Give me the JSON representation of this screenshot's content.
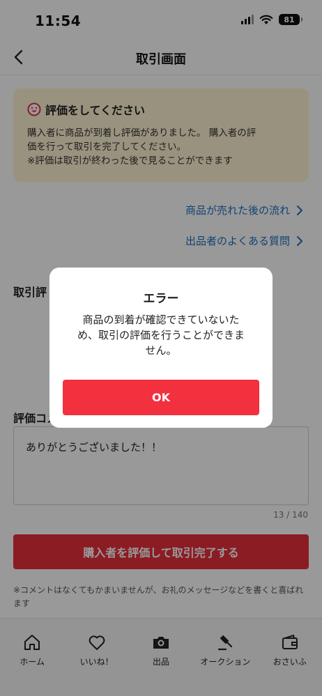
{
  "status_bar": {
    "time": "11:54",
    "battery": "81"
  },
  "nav": {
    "title": "取引画面"
  },
  "notice": {
    "title": "評価をしてください",
    "line1": "購入者に商品が到着し評価がありました。 購入者の評",
    "line2": "価を行って取引を完了してください。",
    "line3": "※評価は取引が終わった後で見ることができます"
  },
  "links": [
    {
      "label": "商品が売れた後の流れ"
    },
    {
      "label": "出品者のよくある質問"
    }
  ],
  "sections": {
    "rating_title": "取引評",
    "comment_title": "評価コメ"
  },
  "comment": {
    "value": "ありがとうございました！！",
    "counter": "13 / 140"
  },
  "submit": {
    "label": "購入者を評価して取引完了する"
  },
  "note": "※コメントはなくてもかまいませんが、お礼のメッセージなどを書くと喜ばれます",
  "tabs": [
    {
      "label": "ホーム",
      "icon": "home-icon"
    },
    {
      "label": "いいね！",
      "icon": "heart-icon"
    },
    {
      "label": "出品",
      "icon": "camera-icon"
    },
    {
      "label": "オークション",
      "icon": "gavel-icon"
    },
    {
      "label": "おさいふ",
      "icon": "wallet-icon"
    }
  ],
  "dialog": {
    "title": "エラー",
    "line1": "商品の到着が確認できていないた",
    "line2": "め、取引の評価を行うことができま",
    "line3": "せん。",
    "ok_label": "OK"
  },
  "colors": {
    "accent_red": "#f2303e",
    "link_blue": "#1d6fbd",
    "notice_bg": "#fff4d2"
  }
}
